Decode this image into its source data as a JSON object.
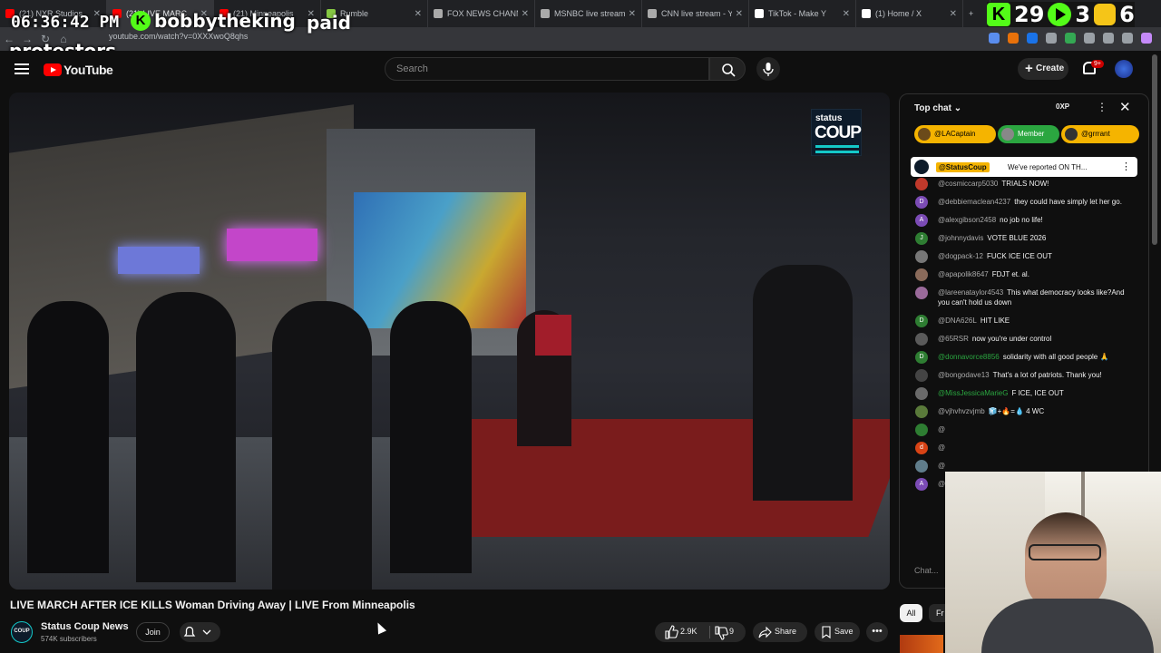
{
  "browser": {
    "tabs": [
      {
        "label": "(21) NXR Studios",
        "color": "#ff0000"
      },
      {
        "label": "(21) LIVE MARC",
        "color": "#ff0000"
      },
      {
        "label": "(21) Minneapolis",
        "color": "#ff0000"
      },
      {
        "label": "Rumble",
        "color": "#85c742"
      },
      {
        "label": "FOX NEWS CHANN",
        "color": "#aaaaaa"
      },
      {
        "label": "MSNBC live stream",
        "color": "#aaaaaa"
      },
      {
        "label": "CNN live stream - Y",
        "color": "#aaaaaa"
      },
      {
        "label": "TikTok - Make Y",
        "color": "#ffffff"
      },
      {
        "label": "(1) Home / X",
        "color": "#ffffff"
      }
    ],
    "url": "youtube.com/watch?v=0XXXwoQ8qhs"
  },
  "overlay": {
    "clock": "06:36:42 PM",
    "k_badge": "K",
    "username": "bobbytheking",
    "paid": "paid",
    "protestors": "protestors",
    "right_k": "K",
    "right_num1": "29",
    "right_num2": "3",
    "right_num3": "6"
  },
  "youtube": {
    "brand": "YouTube",
    "search_placeholder": "Search",
    "create_label": "Create",
    "notif_count": "9+"
  },
  "video": {
    "logo_top": "status",
    "logo_bottom": "COUP",
    "title": "LIVE MARCH AFTER ICE KILLS Woman Driving Away | LIVE From Minneapolis",
    "channel_name": "Status Coup News",
    "channel_avatar": "COUP",
    "subscribers": "574K subscribers",
    "join_label": "Join",
    "likes": "2.9K",
    "dislikes": "9",
    "share_label": "Share",
    "save_label": "Save",
    "more_label": "•••"
  },
  "chat": {
    "header": "Top chat",
    "xp": "0XP",
    "pills": [
      {
        "label": "@LACaptain",
        "bg": "#f5b400"
      },
      {
        "label": "Member",
        "bg": "#2ba640"
      },
      {
        "label": "@grrrant",
        "bg": "#f5b400"
      }
    ],
    "pinned_author": "@StatusCoup",
    "pinned_text": "We've reported ON TH...",
    "messages": [
      {
        "av": "",
        "avc": "#c0392b",
        "author": "@cosmiccarp5030",
        "text": "TRIALS NOW!",
        "member": false
      },
      {
        "av": "D",
        "avc": "#7b4bb5",
        "author": "@debbiemaclean4237",
        "text": "they could have simply let her go.",
        "member": false
      },
      {
        "av": "A",
        "avc": "#7b4bb5",
        "author": "@alexgibson2458",
        "text": "no job no life!",
        "member": false
      },
      {
        "av": "J",
        "avc": "#2e7d32",
        "author": "@johnnydavis",
        "text": "VOTE BLUE 2026",
        "member": false
      },
      {
        "av": "",
        "avc": "#777777",
        "author": "@dogpack-12",
        "text": "FUCK ICE ICE OUT",
        "member": false
      },
      {
        "av": "",
        "avc": "#8a6a5a",
        "author": "@apapolik8647",
        "text": "FDJT et. al.",
        "member": false
      },
      {
        "av": "",
        "avc": "#9a6a9a",
        "author": "@lareenataylor4543",
        "text": "This what democracy looks like?And you can't hold us down",
        "member": false
      },
      {
        "av": "D",
        "avc": "#2e7d32",
        "author": "@DNA626L",
        "text": "HIT LIKE",
        "member": false
      },
      {
        "av": "",
        "avc": "#5a5a5a",
        "author": "@65RSR",
        "text": "now you're under control",
        "member": false
      },
      {
        "av": "D",
        "avc": "#2e7d32",
        "author": "@donnavorce8856",
        "text": "solidarity with all good people 🙏",
        "member": true
      },
      {
        "av": "",
        "avc": "#444444",
        "author": "@bongodave13",
        "text": "That's a lot of patriots. Thank you!",
        "member": false
      },
      {
        "av": "",
        "avc": "#6a6a6a",
        "author": "@MissJessicaMarieG",
        "text": "F ICE, ICE OUT",
        "member": true
      },
      {
        "av": "",
        "avc": "#5a7a3a",
        "author": "@vjhvhvzvjmb",
        "text": "🧊+🔥=💧 4 WC",
        "member": false
      },
      {
        "av": "",
        "avc": "#2e7d32",
        "author": "@",
        "text": "",
        "member": false
      },
      {
        "av": "d",
        "avc": "#d84315",
        "author": "@",
        "text": "",
        "member": false
      },
      {
        "av": "",
        "avc": "#607d8b",
        "author": "@",
        "text": "",
        "member": false
      },
      {
        "av": "A",
        "avc": "#7b4bb5",
        "author": "@",
        "text": "",
        "member": false
      }
    ],
    "input_placeholder": "Chat..."
  },
  "chips": {
    "all": "All",
    "second": "Fr"
  }
}
